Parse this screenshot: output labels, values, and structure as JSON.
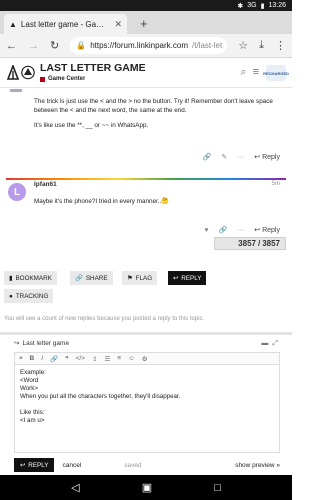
{
  "status_bar": {
    "network": "3G",
    "time": "13:26"
  },
  "browser": {
    "tab_title": "Last letter game - Game Ce",
    "url_host": "https://forum.linkinpark.com",
    "url_path": "/t/last-let"
  },
  "header": {
    "topic_title": "LAST LETTER GAME",
    "category": "Game Center",
    "avatar_text": "RECHARGED"
  },
  "posts": [
    {
      "paragraphs": [
        "The trick is just use the < and the > no the button. Try it! Remember don't leave space between the < and the next word, the same at the end.",
        "It's like use the **, __ or ~~ in WhatsApp."
      ],
      "reply_label": "Reply"
    },
    {
      "username": "lpfan61",
      "avatar_letter": "L",
      "time": "5m",
      "text": "Maybe it's the phone?I tried in every manner..🤔",
      "reply_label": "Reply"
    }
  ],
  "progress": {
    "current": "3857",
    "separator": "/",
    "total": "3857"
  },
  "topic_buttons": {
    "bookmark": "BOOKMARK",
    "share": "SHARE",
    "flag": "FLAG",
    "reply": "REPLY",
    "tracking": "TRACKING"
  },
  "notice": "You will see a count of new replies because you posted a reply to this topic.",
  "composer": {
    "reply_to": "Last letter game",
    "body": "Example:\n<Word\nWork>\nWhen you put all the characters together, they'll disappear.\n\nLike this:\n<I am u>",
    "reply_button": "REPLY",
    "cancel": "cancel",
    "saved": "saved",
    "preview": "show preview »"
  },
  "colors": {
    "accent_dark": "#111111",
    "category_red": "#b10018",
    "avatar_purple": "#b79be8"
  }
}
